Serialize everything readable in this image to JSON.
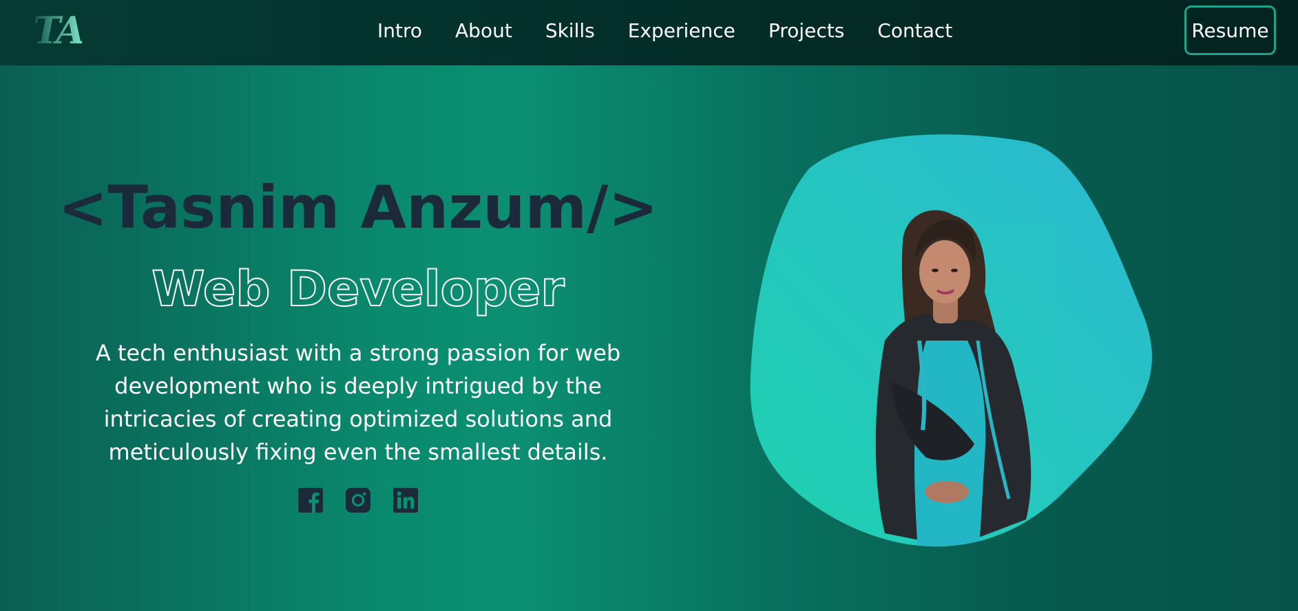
{
  "nav": {
    "logo": "TA",
    "links": [
      "Intro",
      "About",
      "Skills",
      "Experience",
      "Projects",
      "Contact"
    ],
    "resume_label": "Resume"
  },
  "hero": {
    "name": "<Tasnim Anzum/>",
    "role": "Web Developer",
    "bio": "A tech enthusiast with a strong passion for web development who is deeply intrigued by the intricacies of creating optimized solutions and meticulously fixing even the smallest details.",
    "socials": [
      "facebook-icon",
      "instagram-icon",
      "linkedin-icon"
    ]
  },
  "colors": {
    "name_color": "#1b2a3a",
    "accent": "#1ea38c",
    "blob_start": "#1fd1ae",
    "blob_end": "#2bb9d2"
  }
}
